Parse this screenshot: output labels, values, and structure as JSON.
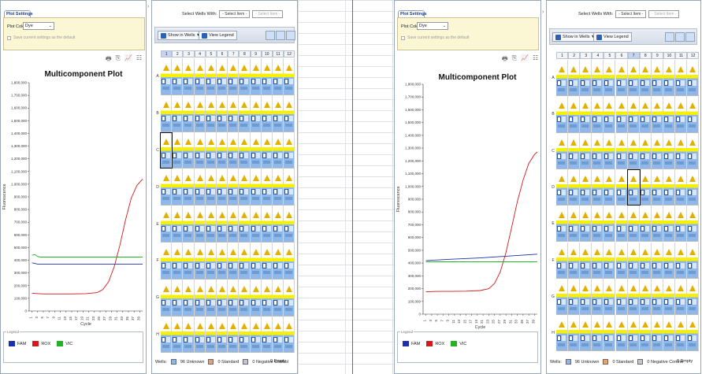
{
  "plot_settings": {
    "tab_label": "Plot Settings",
    "plot_color_label": "Plot Color",
    "plot_color_value": "Dye",
    "save_default_label": "Save current settings as the default"
  },
  "plot": {
    "title": "Multicomponent Plot",
    "ylabel": "Fluorescence",
    "xlabel": "Cycle"
  },
  "legend": {
    "label": "Legend",
    "items": [
      {
        "name": "FAM",
        "color": "#1d2fb0"
      },
      {
        "name": "ROX",
        "color": "#d11a1a"
      },
      {
        "name": "VIC",
        "color": "#22b322"
      }
    ]
  },
  "plate": {
    "select_wells_label": "Select Wells With:",
    "select_item_1": "- Select Item -",
    "select_item_2": "- Select Item -",
    "show_in_wells_label": "Show in Wells ▼",
    "view_legend_label": "View Legend",
    "columns": [
      "1",
      "2",
      "3",
      "4",
      "5",
      "6",
      "7",
      "8",
      "9",
      "10",
      "11",
      "12"
    ],
    "rows": [
      "A",
      "B",
      "C",
      "D",
      "E",
      "F",
      "G",
      "H"
    ],
    "footer": {
      "wells_label": "Wells:",
      "unknown": "96 Unknown",
      "standard": "0 Standard",
      "negative": "0 Negative Control",
      "empty": "0 Empty"
    }
  },
  "chart_data": [
    {
      "type": "line",
      "title": "Multicomponent Plot",
      "xlabel": "Cycle",
      "ylabel": "Fluorescence",
      "xlim": [
        0,
        40
      ],
      "ylim": [
        0,
        1800000
      ],
      "yticks": [
        0,
        100000,
        200000,
        300000,
        400000,
        500000,
        600000,
        700000,
        800000,
        900000,
        1000000,
        1100000,
        1200000,
        1300000,
        1400000,
        1500000,
        1600000,
        1700000,
        1800000
      ],
      "ytick_labels": [
        "0",
        "100,000",
        "200,000",
        "300,000",
        "400,000",
        "500,000",
        "600,000",
        "700,000",
        "800,000",
        "900,000",
        "1,000,000",
        "1,100,000",
        "1,200,000",
        "1,300,000",
        "1,400,000",
        "1,500,000",
        "1,600,000",
        "1,700,000",
        "1,800,000"
      ],
      "xticks": [
        1,
        3,
        5,
        7,
        9,
        11,
        13,
        15,
        17,
        19,
        21,
        23,
        25,
        27,
        29,
        31,
        33,
        35,
        37,
        39
      ],
      "grid": false,
      "legend_placement": "bottom",
      "series": [
        {
          "name": "FAM",
          "color": "#1d2fb0",
          "x": [
            1,
            3,
            6,
            10,
            20,
            30,
            40
          ],
          "y": [
            380000,
            370000,
            370000,
            370000,
            370000,
            370000,
            370000
          ]
        },
        {
          "name": "ROX",
          "color": "#d11a1a",
          "x": [
            1,
            5,
            10,
            15,
            20,
            24,
            26,
            28,
            30,
            32,
            34,
            36,
            38,
            40
          ],
          "y": [
            140000,
            135000,
            135000,
            135000,
            137000,
            145000,
            170000,
            230000,
            350000,
            520000,
            720000,
            890000,
            990000,
            1040000
          ]
        },
        {
          "name": "VIC",
          "color": "#22b322",
          "x": [
            1,
            2,
            3,
            4,
            10,
            20,
            30,
            40
          ],
          "y": [
            440000,
            445000,
            430000,
            425000,
            425000,
            425000,
            425000,
            425000
          ]
        }
      ]
    },
    {
      "type": "line",
      "title": "Multicomponent Plot",
      "xlabel": "Cycle",
      "ylabel": "Fluorescence",
      "xlim": [
        0,
        40
      ],
      "ylim": [
        0,
        1800000
      ],
      "yticks": [
        0,
        100000,
        200000,
        300000,
        400000,
        500000,
        600000,
        700000,
        800000,
        900000,
        1000000,
        1100000,
        1200000,
        1300000,
        1400000,
        1500000,
        1600000,
        1700000,
        1800000
      ],
      "ytick_labels": [
        "0",
        "100,000",
        "200,000",
        "300,000",
        "400,000",
        "500,000",
        "600,000",
        "700,000",
        "800,000",
        "900,000",
        "1,000,000",
        "1,100,000",
        "1,200,000",
        "1,300,000",
        "1,400,000",
        "1,500,000",
        "1,600,000",
        "1,700,000",
        "1,800,000"
      ],
      "xticks": [
        1,
        3,
        5,
        7,
        9,
        11,
        13,
        15,
        17,
        19,
        21,
        23,
        25,
        27,
        29,
        31,
        33,
        35,
        37,
        39
      ],
      "grid": false,
      "legend_placement": "bottom",
      "series": [
        {
          "name": "FAM",
          "color": "#1d2fb0",
          "x": [
            1,
            10,
            20,
            30,
            40
          ],
          "y": [
            420000,
            430000,
            440000,
            455000,
            470000
          ]
        },
        {
          "name": "ROX",
          "color": "#d11a1a",
          "x": [
            1,
            5,
            10,
            15,
            20,
            23,
            25,
            27,
            29,
            31,
            33,
            35,
            37,
            39,
            40
          ],
          "y": [
            175000,
            178000,
            178000,
            180000,
            185000,
            200000,
            240000,
            330000,
            480000,
            680000,
            880000,
            1050000,
            1180000,
            1250000,
            1270000
          ]
        },
        {
          "name": "VIC",
          "color": "#22b322",
          "x": [
            1,
            10,
            20,
            30,
            40
          ],
          "y": [
            410000,
            410000,
            410000,
            410000,
            410000
          ]
        }
      ]
    }
  ]
}
